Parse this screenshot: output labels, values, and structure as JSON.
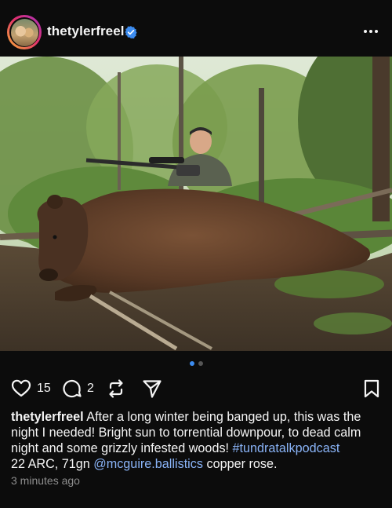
{
  "header": {
    "username": "thetylerfreel",
    "verified_icon": "verified-badge-icon",
    "more_icon": "more-options-icon"
  },
  "photo": {
    "description_icon": "post-photo"
  },
  "pager": {
    "count": 2,
    "active": 1
  },
  "actions": {
    "like_count": "15",
    "comment_count": "2",
    "icons": [
      "heart-icon",
      "comment-icon",
      "repost-icon",
      "share-icon",
      "bookmark-icon"
    ]
  },
  "caption": {
    "username": "thetylerfreel",
    "text_1": " After a long winter being banged up, this was the night I needed! Bright sun to torrential downpour, to dead calm night and some grizzly infested woods! ",
    "hashtag": "#tundratalkpodcast",
    "text_2": "22 ARC, 71gn ",
    "mention": "@mcguire.ballistics",
    "text_3": " copper rose."
  },
  "timestamp": "3 minutes ago",
  "colors": {
    "background": "#0c0c0c",
    "link": "#8ab4f8",
    "verified": "#3c8cf0",
    "muted": "#8e8e8e"
  }
}
